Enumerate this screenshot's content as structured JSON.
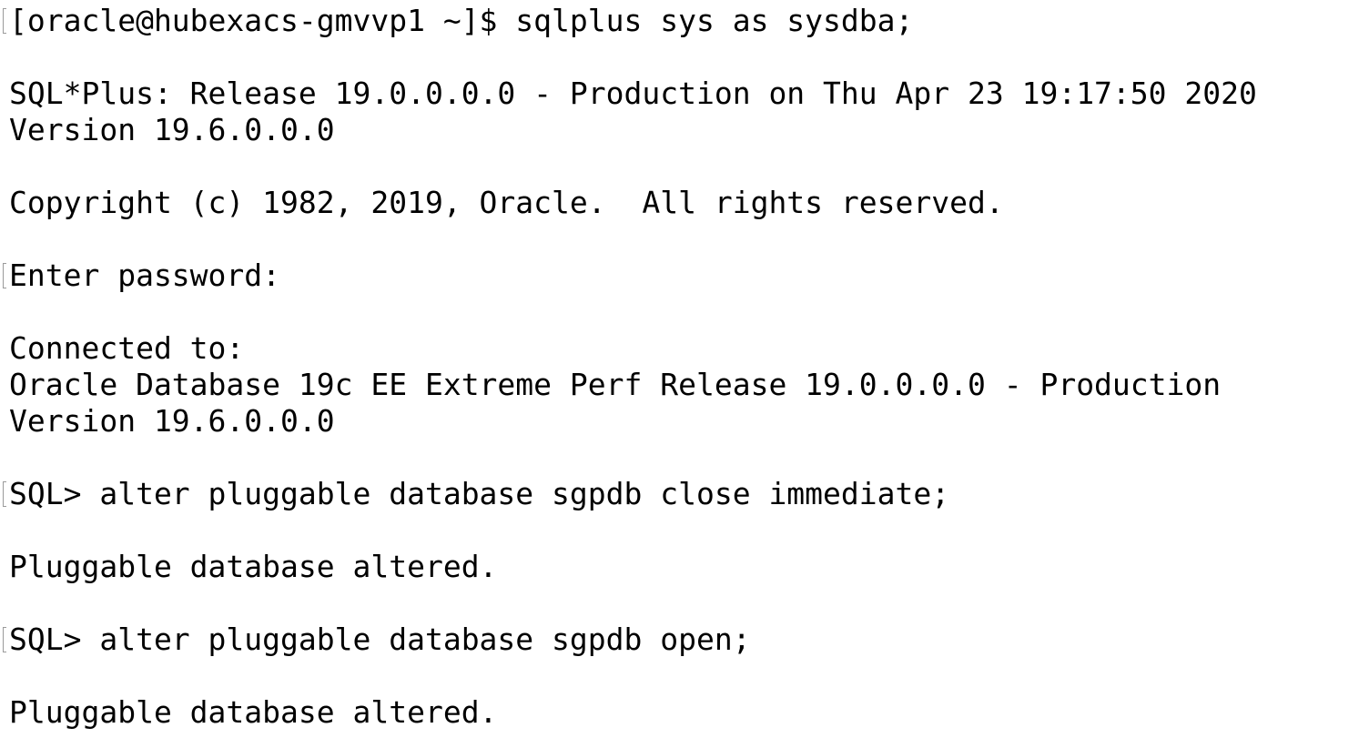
{
  "terminal": {
    "lines": [
      "[oracle@hubexacs-gmvvp1 ~]$ sqlplus sys as sysdba;",
      "",
      "SQL*Plus: Release 19.0.0.0.0 - Production on Thu Apr 23 19:17:50 2020",
      "Version 19.6.0.0.0",
      "",
      "Copyright (c) 1982, 2019, Oracle.  All rights reserved.",
      "",
      "Enter password:",
      "",
      "Connected to:",
      "Oracle Database 19c EE Extreme Perf Release 19.0.0.0.0 - Production",
      "Version 19.6.0.0.0",
      "",
      "SQL> alter pluggable database sgpdb close immediate;",
      "",
      "Pluggable database altered.",
      "",
      "SQL> alter pluggable database sgpdb open;",
      "",
      "Pluggable database altered."
    ]
  }
}
